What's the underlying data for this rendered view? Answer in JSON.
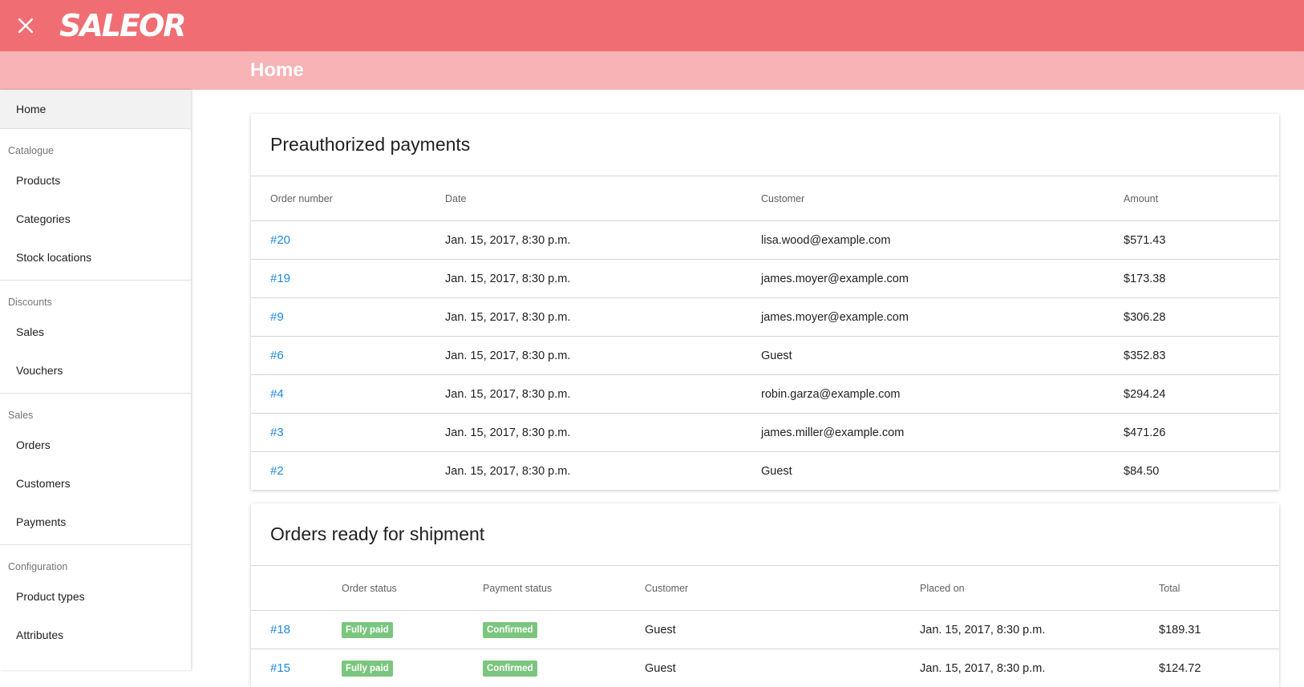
{
  "app": {
    "logo": "SALEOR",
    "page_title": "Home"
  },
  "sidebar": {
    "home": "Home",
    "sections": [
      {
        "heading": "Catalogue",
        "items": [
          "Products",
          "Categories",
          "Stock locations"
        ]
      },
      {
        "heading": "Discounts",
        "items": [
          "Sales",
          "Vouchers"
        ]
      },
      {
        "heading": "Sales",
        "items": [
          "Orders",
          "Customers",
          "Payments"
        ]
      },
      {
        "heading": "Configuration",
        "items": [
          "Product types",
          "Attributes"
        ]
      }
    ]
  },
  "preauthorized": {
    "title": "Preauthorized payments",
    "headers": [
      "Order number",
      "Date",
      "Customer",
      "Amount"
    ],
    "rows": [
      {
        "order": "#20",
        "date": "Jan. 15, 2017, 8:30 p.m.",
        "customer": "lisa.wood@example.com",
        "amount": "$571.43"
      },
      {
        "order": "#19",
        "date": "Jan. 15, 2017, 8:30 p.m.",
        "customer": "james.moyer@example.com",
        "amount": "$173.38"
      },
      {
        "order": "#9",
        "date": "Jan. 15, 2017, 8:30 p.m.",
        "customer": "james.moyer@example.com",
        "amount": "$306.28"
      },
      {
        "order": "#6",
        "date": "Jan. 15, 2017, 8:30 p.m.",
        "customer": "Guest",
        "amount": "$352.83"
      },
      {
        "order": "#4",
        "date": "Jan. 15, 2017, 8:30 p.m.",
        "customer": "robin.garza@example.com",
        "amount": "$294.24"
      },
      {
        "order": "#3",
        "date": "Jan. 15, 2017, 8:30 p.m.",
        "customer": "james.miller@example.com",
        "amount": "$471.26"
      },
      {
        "order": "#2",
        "date": "Jan. 15, 2017, 8:30 p.m.",
        "customer": "Guest",
        "amount": "$84.50"
      }
    ]
  },
  "shipment": {
    "title": "Orders ready for shipment",
    "headers": [
      "",
      "Order status",
      "Payment status",
      "Customer",
      "Placed on",
      "Total"
    ],
    "rows": [
      {
        "order": "#18",
        "order_status": "Fully paid",
        "payment_status": "Confirmed",
        "customer": "Guest",
        "placed_on": "Jan. 15, 2017, 8:30 p.m.",
        "total": "$189.31"
      },
      {
        "order": "#15",
        "order_status": "Fully paid",
        "payment_status": "Confirmed",
        "customer": "Guest",
        "placed_on": "Jan. 15, 2017, 8:30 p.m.",
        "total": "$124.72"
      }
    ]
  },
  "colors": {
    "topbar": "#f06e73",
    "subbar": "#f7b3b5",
    "link": "#1e88e5",
    "badge": "#7bc67e"
  },
  "icons": {
    "close": "close-icon"
  }
}
